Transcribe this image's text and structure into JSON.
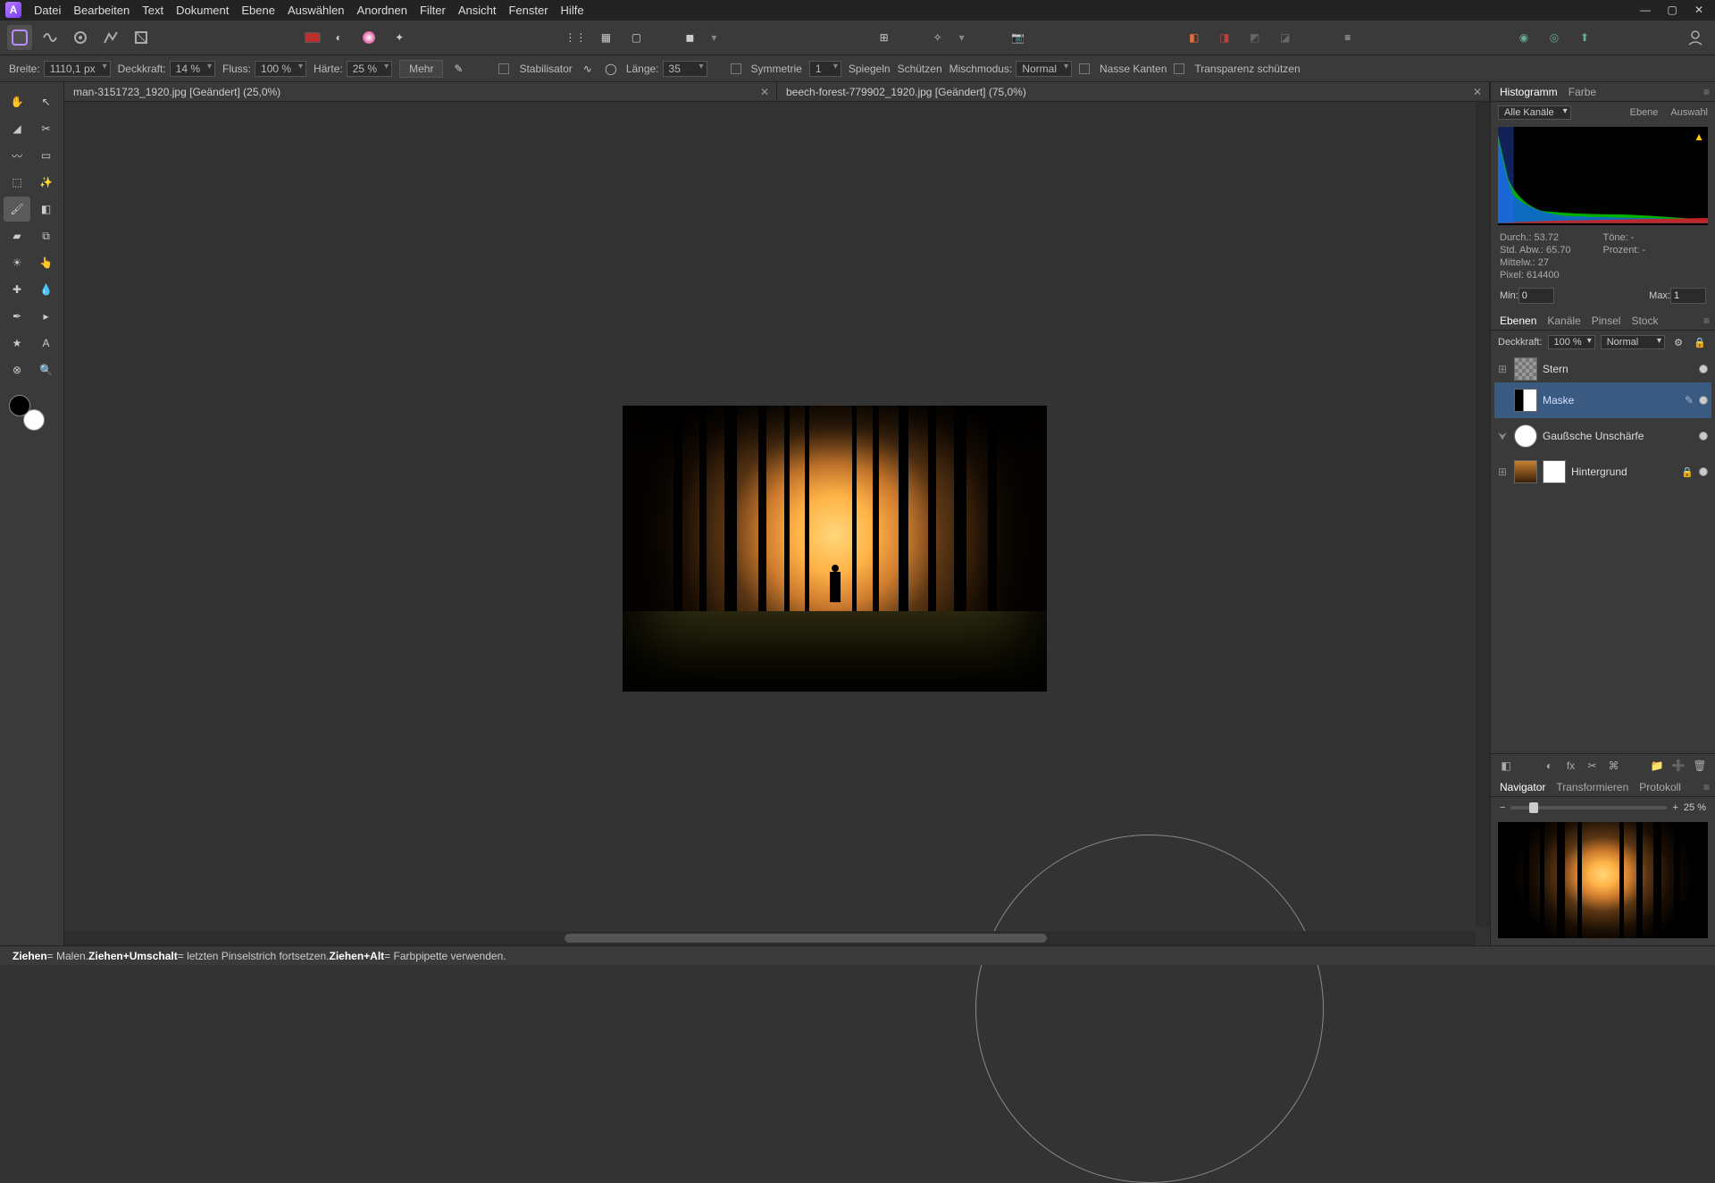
{
  "menu": [
    "Datei",
    "Bearbeiten",
    "Text",
    "Dokument",
    "Ebene",
    "Auswählen",
    "Anordnen",
    "Filter",
    "Ansicht",
    "Fenster",
    "Hilfe"
  ],
  "context": {
    "width_label": "Breite:",
    "width_value": "1110,1 px",
    "opacity_label": "Deckkraft:",
    "opacity_value": "14 %",
    "flow_label": "Fluss:",
    "flow_value": "100 %",
    "hardness_label": "Härte:",
    "hardness_value": "25 %",
    "more": "Mehr",
    "stabilizer": "Stabilisator",
    "length_label": "Länge:",
    "length_value": "35",
    "symmetry": "Symmetrie",
    "symmetry_value": "1",
    "mirror": "Spiegeln",
    "protect": "Schützen",
    "blendmode_label": "Mischmodus:",
    "blendmode_value": "Normal",
    "wetedges": "Nasse Kanten",
    "protect_trans": "Transparenz schützen"
  },
  "tabs": [
    {
      "label": "man-3151723_1920.jpg [Geändert] (25,0%)"
    },
    {
      "label": "beech-forest-779902_1920.jpg [Geändert] (75,0%)"
    }
  ],
  "histogram_panel": {
    "tab1": "Histogramm",
    "tab2": "Farbe",
    "channels": "Alle Kanäle",
    "btn_layer": "Ebene",
    "btn_sel": "Auswahl",
    "stats": {
      "mean": "Durch.: 53.72",
      "std": "Std. Abw.: 65.70",
      "median": "Mittelw.: 27",
      "pixels": "Pixel: 614400",
      "tone": "Töne: -",
      "percent": "Prozent: -"
    },
    "min_label": "Min:",
    "min_value": "0",
    "max_label": "Max:",
    "max_value": "1"
  },
  "layers_panel": {
    "tabs": [
      "Ebenen",
      "Kanäle",
      "Pinsel",
      "Stock"
    ],
    "opacity_label": "Deckkraft:",
    "opacity_value": "100 %",
    "blend_value": "Normal",
    "layers": [
      {
        "name": "Stern"
      },
      {
        "name": "Maske"
      },
      {
        "name": "Gaußsche Unschärfe"
      },
      {
        "name": "Hintergrund"
      }
    ]
  },
  "navigator_panel": {
    "tabs": [
      "Navigator",
      "Transformieren",
      "Protokoll"
    ],
    "zoom": "25 %"
  },
  "status": {
    "s1": "Ziehen",
    "s1t": " = Malen. ",
    "s2": "Ziehen+Umschalt",
    "s2t": " = letzten Pinselstrich fortsetzen. ",
    "s3": "Ziehen+Alt",
    "s3t": " = Farbpipette verwenden."
  }
}
